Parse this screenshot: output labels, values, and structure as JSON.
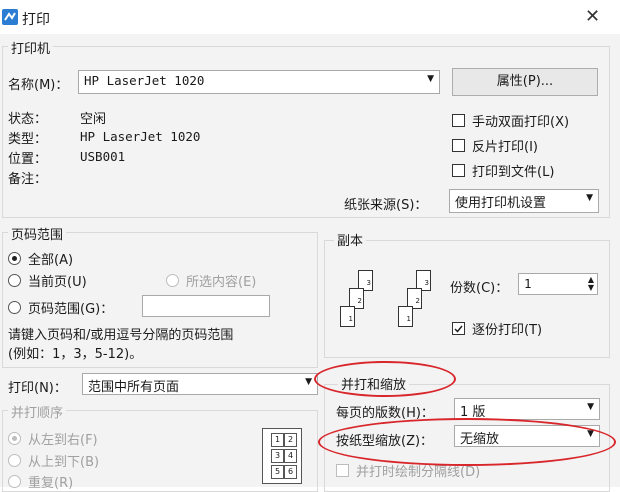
{
  "window": {
    "title": "打印",
    "close_glyph": "✕"
  },
  "printer": {
    "group_label": "打印机",
    "name_label": "名称(M)：",
    "name_value": "HP LaserJet 1020",
    "properties_button": "属性(P)...",
    "status_label": "状态：",
    "status_value": "空闲",
    "type_label": "类型：",
    "type_value": "HP LaserJet 1020",
    "location_label": "位置：",
    "location_value": "USB001",
    "comment_label": "备注：",
    "manual_duplex": "手动双面打印(X)",
    "reverse_print": "反片打印(I)",
    "print_to_file": "打印到文件(L)",
    "paper_source_label": "纸张来源(S)：",
    "paper_source_value": "使用打印机设置"
  },
  "page_range": {
    "group_label": "页码范围",
    "all": "全部(A)",
    "current_page": "当前页(U)",
    "selection": "所选内容(E)",
    "pages": "页码范围(G)：",
    "pages_value": "",
    "hint_line1": "请键入页码和/或用逗号分隔的页码范围",
    "hint_line2": "(例如：1，3，5-12)。"
  },
  "print_what": {
    "label": "打印(N)：",
    "value": "范围中所有页面"
  },
  "order": {
    "group_label": "并打顺序",
    "left_to_right": "从左到右(F)",
    "top_to_bottom": "从上到下(B)",
    "repeat": "重复(R)",
    "grid": [
      "1",
      "2",
      "3",
      "4",
      "5",
      "6"
    ]
  },
  "copies": {
    "group_label": "副本",
    "count_label": "份数(C)：",
    "count_value": "1",
    "collate": "逐份打印(T)",
    "page_digits": [
      "3",
      "2",
      "1"
    ]
  },
  "zoom": {
    "group_label": "并打和缩放",
    "pages_per_sheet_label": "每页的版数(H)：",
    "pages_per_sheet_value": "1 版",
    "scale_label": "按纸型缩放(Z)：",
    "scale_value": "无缩放",
    "draw_border": "并打时绘制分隔线(D)"
  },
  "annotation": {
    "color": "#d8262b"
  }
}
